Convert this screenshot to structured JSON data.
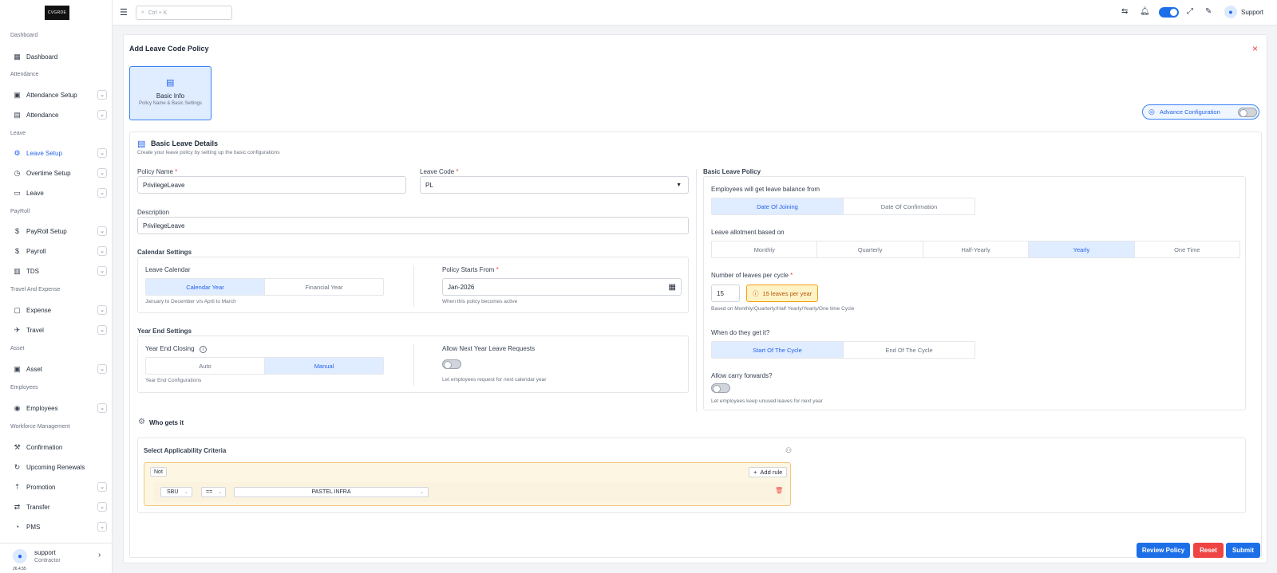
{
  "sidebar": {
    "logo": "CVGRDE",
    "sections": [
      "Dashboard",
      "Attendance",
      "Leave",
      "PayRoll",
      "Travel And Expense",
      "Asset",
      "Employees",
      "Workforce Management"
    ],
    "items": [
      {
        "label": "Dashboard",
        "icon": "grid-icon"
      },
      {
        "label": "Attendance Setup",
        "icon": "calendar-check-icon"
      },
      {
        "label": "Attendance",
        "icon": "calendar-icon"
      },
      {
        "label": "Leave Setup",
        "icon": "gear-icon"
      },
      {
        "label": "Overtime Setup",
        "icon": "clock-icon"
      },
      {
        "label": "Leave",
        "icon": "briefcase-icon"
      },
      {
        "label": "PayRoll Setup",
        "icon": "money-gear-icon"
      },
      {
        "label": "Payroll",
        "icon": "money-icon"
      },
      {
        "label": "TDS",
        "icon": "receipt-icon"
      },
      {
        "label": "Expense",
        "icon": "wallet-icon"
      },
      {
        "label": "Travel",
        "icon": "plane-icon"
      },
      {
        "label": "Asset",
        "icon": "box-icon"
      },
      {
        "label": "Employees",
        "icon": "user-circle-icon"
      },
      {
        "label": "Confirmation",
        "icon": "gavel-icon"
      },
      {
        "label": "Upcoming Renewals",
        "icon": "refresh-doc-icon"
      },
      {
        "label": "Promotion",
        "icon": "promotion-icon"
      },
      {
        "label": "Transfer",
        "icon": "transfer-icon"
      },
      {
        "label": "PMS",
        "icon": "gauge-icon"
      }
    ],
    "user": {
      "name": "support",
      "role": "Contractor",
      "version": "26.4.55"
    }
  },
  "topbar": {
    "search_placeholder": "Ctrl + K",
    "user_label": "Support"
  },
  "form": {
    "title": "Add Leave Code Policy",
    "step": {
      "title": "Basic Info",
      "subtitle": "Policy Name & Basic Settings"
    },
    "advance_config": "Advance Configuration",
    "section_title": "Basic Leave Details",
    "section_subtitle": "Create your leave policy by setting up the basic configurations",
    "policy_name_label": "Policy Name",
    "policy_name_value": "PrivilegeLeave",
    "leave_code_label": "Leave Code",
    "leave_code_value": "PL",
    "description_label": "Description",
    "description_value": "PrivilegeLeave",
    "calendar_settings": "Calendar Settings",
    "leave_calendar_label": "Leave Calendar",
    "calendar_options": [
      "Calendar Year",
      "Financial Year"
    ],
    "calendar_hint": "January to December v/s April to March",
    "policy_start_label": "Policy Starts From",
    "policy_start_value": "Jan-2026",
    "policy_start_hint": "When this policy becomes active",
    "year_end_settings": "Year End Settings",
    "year_end_closing_label": "Year End Closing",
    "year_end_options": [
      "Auto",
      "Manual"
    ],
    "year_end_hint": "Year End Configurations",
    "next_year_label": "Allow Next Year Leave Requests",
    "next_year_hint": "Let employees request for next calendar year"
  },
  "policy": {
    "title": "Basic Leave Policy",
    "balance_from_label": "Employees will get leave balance from",
    "balance_options": [
      "Date Of Joining",
      "Date Of Confirmation"
    ],
    "allotment_label": "Leave allotment based on",
    "allotment_options": [
      "Monthly",
      "Quarterly",
      "Half-Yearly",
      "Yearly",
      "One Time"
    ],
    "leaves_per_cycle_label": "Number of leaves per cycle",
    "leaves_per_cycle_value": "15",
    "leaves_badge": "15 leaves per year",
    "leaves_hint": "Based on Monthly/Quarterly/Half Yearly/Yearly/One time Cycle",
    "when_label": "When do they get it?",
    "when_options": [
      "Start Of The Cycle",
      "End Of The Cycle"
    ],
    "carry_label": "Allow carry forwards?",
    "carry_hint": "Let employees keep unused leaves for next year"
  },
  "who": {
    "title": "Who gets it",
    "criteria_label": "Select Applicability Criteria",
    "not_label": "Not",
    "add_rule": "Add rule",
    "rule_field": "SBU",
    "rule_op": "==",
    "rule_value": "PASTEL INFRA"
  },
  "actions": {
    "review": "Review Policy",
    "reset": "Reset",
    "submit": "Submit"
  },
  "colors": {
    "primary": "#1d6fe8",
    "danger": "#ef4444",
    "accent_light": "#e0ecff"
  }
}
